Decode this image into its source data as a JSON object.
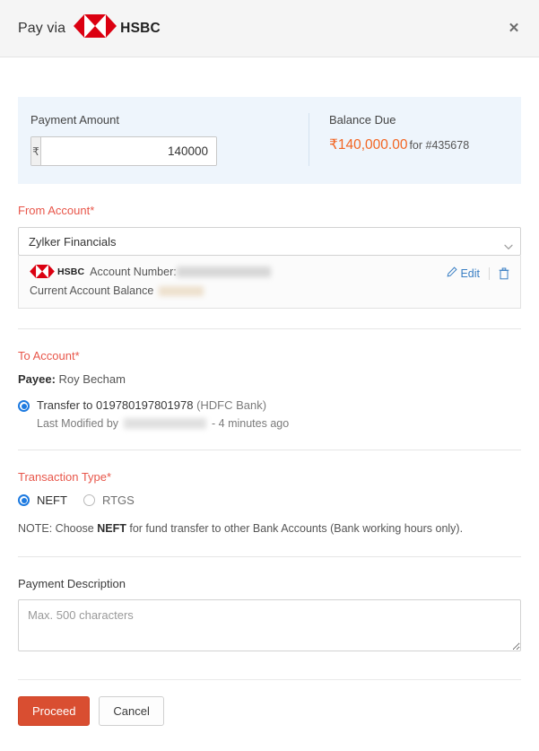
{
  "header": {
    "title": "Pay via",
    "bank_name": "HSBC",
    "bank_logo_icon": "hsbc-hexagon-logo",
    "close_icon": "close-icon",
    "close_label": "✕"
  },
  "summary": {
    "amount_label": "Payment Amount",
    "currency_symbol": "₹",
    "amount_value": "140000",
    "amount_placeholder": "",
    "balance_label": "Balance Due",
    "balance_amount": "₹140,000.00",
    "balance_for": "for #435678"
  },
  "from_account": {
    "label": "From Account*",
    "selected": "Zylker Financials",
    "chevron_icon": "chevron-down-icon",
    "card": {
      "bank_logo_icon": "hsbc-hexagon-logo",
      "bank_name": "HSBC",
      "account_number_label": "Account Number:",
      "account_number_value": "",
      "balance_label": "Current Account Balance",
      "balance_value": "",
      "edit_label": "Edit",
      "edit_icon": "pencil-icon",
      "delete_icon": "trash-icon"
    }
  },
  "to_account": {
    "label": "To Account*",
    "payee_key": "Payee:",
    "payee_value": "Roy Becham",
    "transfer_prefix": "Transfer to",
    "transfer_account": "019780197801978",
    "transfer_bank": "(HDFC Bank)",
    "transfer_selected": true,
    "last_modified_prefix": "Last Modified by",
    "last_modified_by": "",
    "last_modified_time": "- 4 minutes ago"
  },
  "transaction_type": {
    "label": "Transaction Type*",
    "options": [
      {
        "label": "NEFT",
        "selected": true
      },
      {
        "label": "RTGS",
        "selected": false
      }
    ],
    "note_prefix": "NOTE: Choose ",
    "note_bold": "NEFT",
    "note_suffix": " for fund transfer to other Bank Accounts (Bank working hours only)."
  },
  "description": {
    "label": "Payment Description",
    "placeholder": "Max. 500 characters",
    "value": ""
  },
  "footer": {
    "proceed_label": "Proceed",
    "cancel_label": "Cancel"
  },
  "colors": {
    "accent_red": "#d94e31",
    "required_red": "#e8564a",
    "balance_orange": "#f26522",
    "link_blue": "#3a7fc4",
    "radio_blue": "#1d7ae0",
    "panel_blue": "#eef5fc",
    "hsbc_red": "#db0011"
  }
}
